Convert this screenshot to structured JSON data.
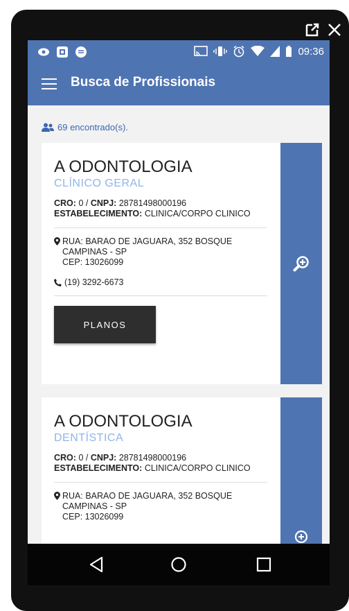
{
  "statusbar": {
    "time": "09:36",
    "left_icons": [
      "eye-icon",
      "grid-icon",
      "message-icon"
    ],
    "right_icons": [
      "cast-icon",
      "vibrate-icon",
      "alarm-icon",
      "wifi-icon",
      "signal-icon",
      "battery-icon"
    ]
  },
  "window_controls": {
    "icons": [
      "open-external-icon",
      "close-icon"
    ]
  },
  "appbar": {
    "title": "Busca de Profissionais",
    "menu_icon": "hamburger-icon"
  },
  "results": {
    "count_text": "69 encontrado(s).",
    "icon": "users-icon"
  },
  "cards": [
    {
      "name": "A ODONTOLOGIA",
      "specialty": "CLÍNICO GERAL",
      "cro_label": "CRO:",
      "cro_value": "0 / ",
      "cnpj_label": "CNPJ:",
      "cnpj_value": "28781498000196",
      "estab_label": "ESTABELECIMENTO:",
      "estab_value": "CLINICA/CORPO CLINICO",
      "address_line1": "RUA: BARAO DE JAGUARA, 352 BOSQUE",
      "address_line2": "CAMPINAS - SP",
      "cep": "CEP: 13026099",
      "phone": "(19) 3292-6673",
      "button_label": "PLANOS"
    },
    {
      "name": "A ODONTOLOGIA",
      "specialty": "DENTÍSTICA",
      "cro_label": "CRO:",
      "cro_value": "0 / ",
      "cnpj_label": "CNPJ:",
      "cnpj_value": "28781498000196",
      "estab_label": "ESTABELECIMENTO:",
      "estab_value": "CLINICA/CORPO CLINICO",
      "address_line1": "RUA: BARAO DE JAGUARA, 352 BOSQUE",
      "address_line2": "CAMPINAS - SP",
      "cep": "CEP: 13026099"
    }
  ],
  "navbar": {
    "buttons": [
      "back-icon",
      "home-icon",
      "recents-icon"
    ]
  },
  "colors": {
    "primary": "#4f74b2",
    "accent_text": "#3a67b0",
    "specialty": "#8fb5e8",
    "button": "#2e2e2e"
  }
}
